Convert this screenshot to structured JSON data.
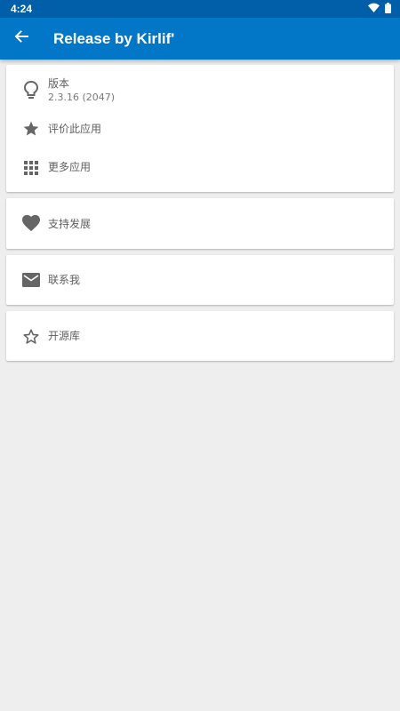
{
  "status_bar": {
    "time": "4:24",
    "icons": [
      "wifi-icon",
      "battery-icon"
    ]
  },
  "app_bar": {
    "back_icon": "arrow-left-icon",
    "title": "Release by Kirlif'"
  },
  "colors": {
    "status_bar": "#005fa8",
    "app_bar": "#0277c8",
    "background": "#eeeeee",
    "card": "#ffffff",
    "icon": "#666666",
    "text": "#5f5f5f"
  },
  "cards": [
    {
      "rows": [
        {
          "icon": "lightbulb-icon",
          "label": "版本",
          "sub": "2.3.16 (2047)"
        },
        {
          "icon": "star-icon",
          "label": "评价此应用"
        },
        {
          "icon": "apps-grid-icon",
          "label": "更多应用"
        }
      ]
    },
    {
      "rows": [
        {
          "icon": "heart-icon",
          "label": "支持发展"
        }
      ]
    },
    {
      "rows": [
        {
          "icon": "email-icon",
          "label": "联系我"
        }
      ]
    },
    {
      "rows": [
        {
          "icon": "star-outline-icon",
          "label": "开源库"
        }
      ]
    }
  ]
}
